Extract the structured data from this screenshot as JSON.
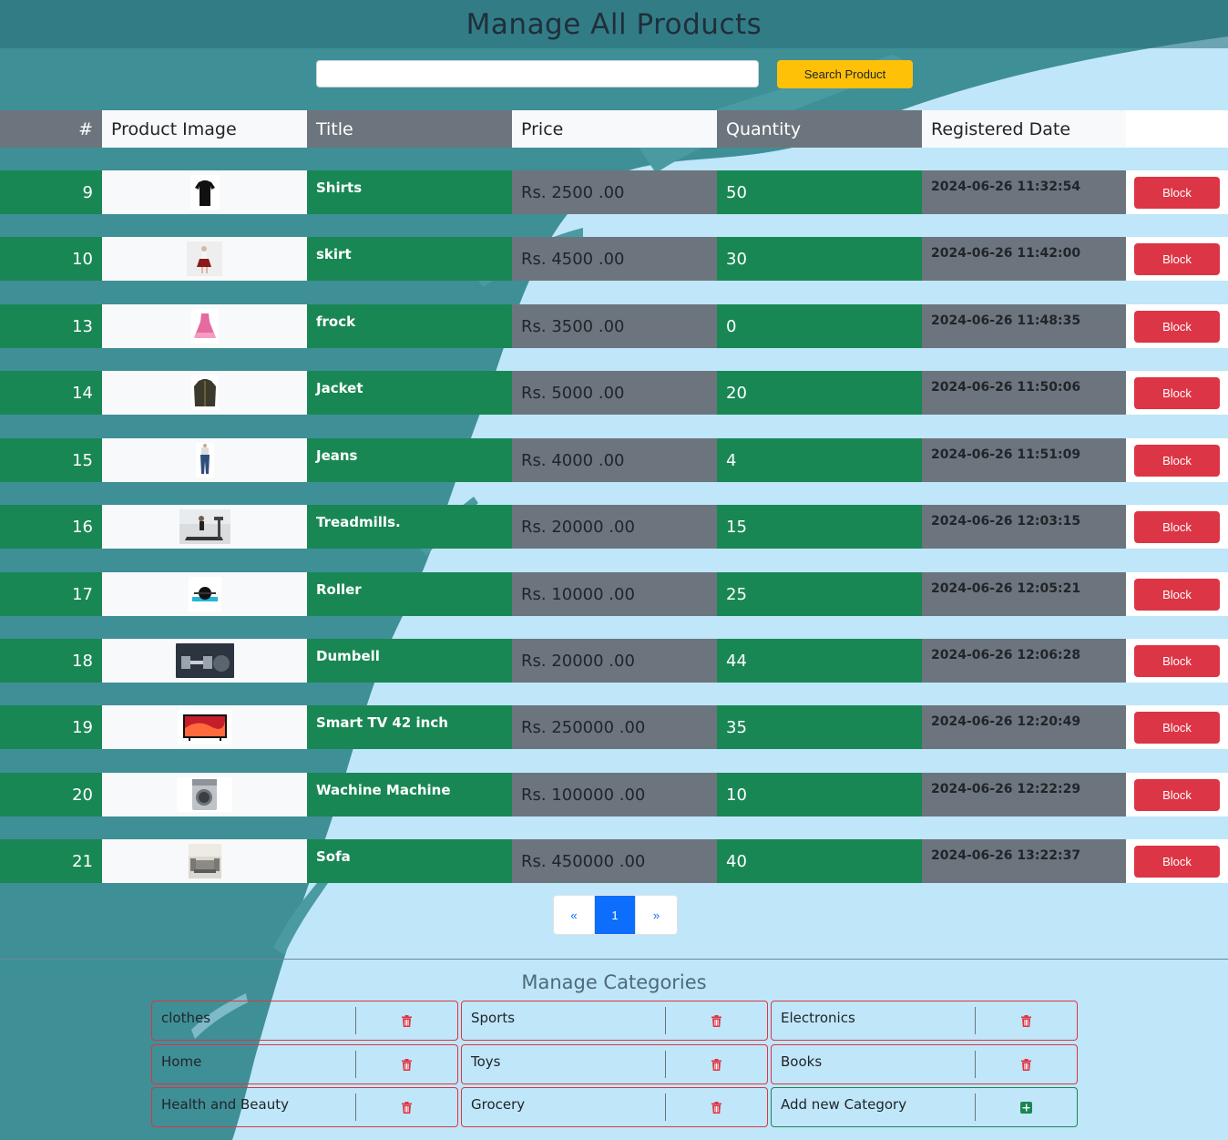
{
  "page_title": "Manage All Products",
  "search": {
    "placeholder": "",
    "value": "",
    "button_label": "Search Product"
  },
  "table": {
    "headers": [
      "#",
      "Product Image",
      "Title",
      "Price",
      "Quantity",
      "Registered Date",
      ""
    ],
    "action_label": "Block",
    "rows": [
      {
        "id": "9",
        "title": "Shirts",
        "price": "Rs. 2500 .00",
        "qty": "50",
        "date": "2024-06-26 11:32:54",
        "img": "shirt-thumbnail"
      },
      {
        "id": "10",
        "title": "skirt",
        "price": "Rs. 4500 .00",
        "qty": "30",
        "date": "2024-06-26 11:42:00",
        "img": "skirt-thumbnail"
      },
      {
        "id": "13",
        "title": "frock",
        "price": "Rs. 3500 .00",
        "qty": "0",
        "date": "2024-06-26 11:48:35",
        "img": "frock-thumbnail"
      },
      {
        "id": "14",
        "title": "Jacket",
        "price": "Rs. 5000 .00",
        "qty": "20",
        "date": "2024-06-26 11:50:06",
        "img": "jacket-thumbnail"
      },
      {
        "id": "15",
        "title": "Jeans",
        "price": "Rs. 4000 .00",
        "qty": "4",
        "date": "2024-06-26 11:51:09",
        "img": "jeans-thumbnail"
      },
      {
        "id": "16",
        "title": "Treadmills.",
        "price": "Rs. 20000 .00",
        "qty": "15",
        "date": "2024-06-26 12:03:15",
        "img": "treadmill-thumbnail"
      },
      {
        "id": "17",
        "title": "Roller",
        "price": "Rs. 10000 .00",
        "qty": "25",
        "date": "2024-06-26 12:05:21",
        "img": "roller-thumbnail"
      },
      {
        "id": "18",
        "title": "Dumbell",
        "price": "Rs. 20000 .00",
        "qty": "44",
        "date": "2024-06-26 12:06:28",
        "img": "dumbell-thumbnail"
      },
      {
        "id": "19",
        "title": "Smart TV 42 inch",
        "price": "Rs. 250000 .00",
        "qty": "35",
        "date": "2024-06-26 12:20:49",
        "img": "tv-thumbnail"
      },
      {
        "id": "20",
        "title": "Wachine Machine",
        "price": "Rs. 100000 .00",
        "qty": "10",
        "date": "2024-06-26 12:22:29",
        "img": "washing-machine-thumbnail"
      },
      {
        "id": "21",
        "title": "Sofa",
        "price": "Rs. 450000 .00",
        "qty": "40",
        "date": "2024-06-26 13:22:37",
        "img": "sofa-thumbnail"
      }
    ]
  },
  "pagination": {
    "prev": "«",
    "current": "1",
    "next": "»"
  },
  "categories": {
    "title": "Manage Categories",
    "items": [
      "clothes",
      "Sports",
      "Electronics",
      "Home",
      "Toys",
      "Books",
      "Health and Beauty",
      "Grocery"
    ],
    "add_label": "Add new Category",
    "delete_icon": "trash-icon",
    "add_icon": "plus-square-icon"
  },
  "colors": {
    "success": "#198754",
    "secondary": "#6c757d",
    "light": "#f8f9fa",
    "danger": "#dc3545",
    "warning": "#ffc107",
    "primary": "#0d6efd",
    "background": "#bfe6f9",
    "brush": "#3f8f97"
  }
}
